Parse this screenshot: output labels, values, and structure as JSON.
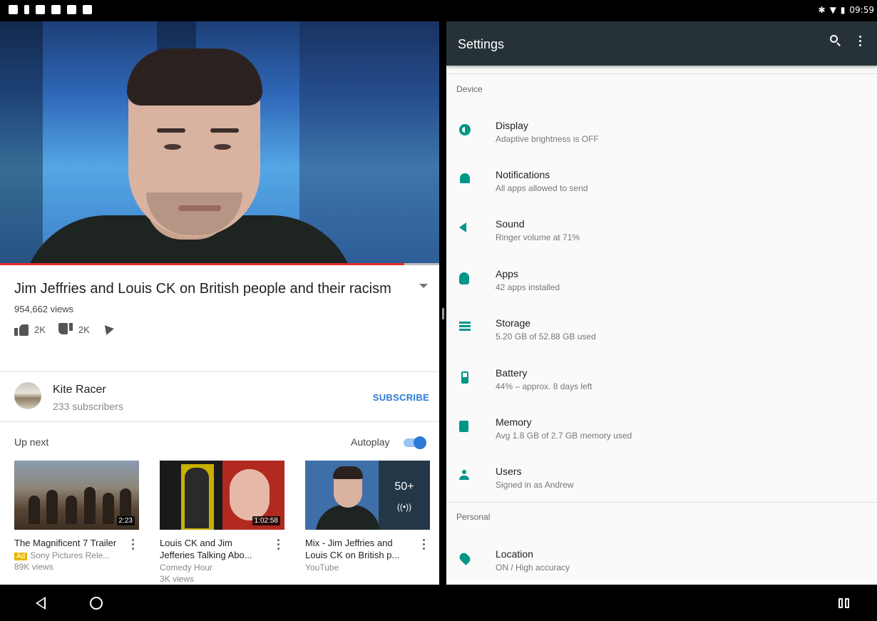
{
  "status_bar": {
    "time": "09:59",
    "bluetooth": "✱",
    "wifi": "▼",
    "battery": "▮"
  },
  "video": {
    "title": "Jim Jeffries and Louis CK on British people and their racism",
    "views": "954,662 views",
    "likes": "2K",
    "dislikes": "2K",
    "progress": 0.92
  },
  "channel": {
    "name": "Kite Racer",
    "subscribers": "233 subscribers",
    "subscribe_label": "SUBSCRIBE"
  },
  "up_next": {
    "label": "Up next",
    "autoplay_label": "Autoplay",
    "autoplay_on": true,
    "cards": [
      {
        "title": "The Magnificent 7 Trailer",
        "badge": "Ad",
        "meta": "Sony Pictures Rele...",
        "meta2": "89K views",
        "duration": "2:23"
      },
      {
        "title": "Louis CK  and Jim Jefferies Talking Abo...",
        "meta": "Comedy Hour",
        "meta2": "3K views",
        "duration": "1:02:58"
      },
      {
        "title": "Mix - Jim Jeffries and Louis CK on British p...",
        "meta": "YouTube",
        "count": "50+",
        "mix_icon": "((•))"
      }
    ]
  },
  "settings": {
    "title": "Settings",
    "sections": {
      "device": "Device",
      "personal": "Personal"
    },
    "items": [
      {
        "title": "Display",
        "subtitle": "Adaptive brightness is OFF",
        "icon": "brightness-icon"
      },
      {
        "title": "Notifications",
        "subtitle": "All apps allowed to send",
        "icon": "bell-icon"
      },
      {
        "title": "Sound",
        "subtitle": "Ringer volume at 71%",
        "icon": "volume-icon"
      },
      {
        "title": "Apps",
        "subtitle": "42 apps installed",
        "icon": "android-icon"
      },
      {
        "title": "Storage",
        "subtitle": "5.20 GB of 52.88 GB used",
        "icon": "storage-icon"
      },
      {
        "title": "Battery",
        "subtitle": "44% – approx. 8 days left",
        "icon": "battery-icon"
      },
      {
        "title": "Memory",
        "subtitle": "Avg 1.8 GB of 2.7 GB memory used",
        "icon": "memory-icon"
      },
      {
        "title": "Users",
        "subtitle": "Signed in as Andrew",
        "icon": "person-icon"
      },
      {
        "title": "Location",
        "subtitle": "ON / High accuracy",
        "icon": "location-pin-icon"
      }
    ]
  },
  "colors": {
    "accent": "#009688",
    "toolbar": "#263238",
    "link": "#2b7bd6",
    "progress": "#e52d27"
  }
}
